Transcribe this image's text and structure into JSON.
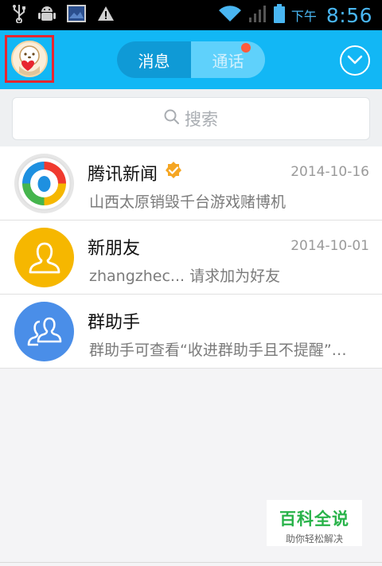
{
  "status_bar": {
    "ampm": "下午",
    "time": "8:56",
    "icons": [
      "usb-icon",
      "android-debug-icon",
      "screenshot-icon",
      "warning-icon",
      "wifi-icon",
      "signal-icon",
      "battery-icon"
    ]
  },
  "header": {
    "tabs": [
      {
        "label": "消息",
        "active": true
      },
      {
        "label": "通话",
        "active": false,
        "badge_dot": true
      }
    ],
    "more_icon": "chevron-down-circle-icon"
  },
  "search": {
    "placeholder": "搜索"
  },
  "conversations": [
    {
      "name": "腾讯新闻",
      "verified": true,
      "date": "2014-10-16",
      "preview": "山西太原销毁千台游戏赌博机",
      "avatar": "tencent-news-icon"
    },
    {
      "name": "新朋友",
      "verified": false,
      "date": "2014-10-01",
      "preview": "zhangzhec... 请求加为好友",
      "avatar": "new-friend-icon",
      "avatar_color": "#f6b700"
    },
    {
      "name": "群助手",
      "verified": false,
      "date": "",
      "preview": "群助手可查看“收进群助手且不提醒”…",
      "avatar": "group-helper-icon",
      "avatar_color": "#4a8ee8"
    }
  ],
  "watermark": {
    "title": "百科全说",
    "subtitle": "助你轻松解决"
  },
  "colors": {
    "accent": "#12b7f5",
    "badge": "#ff5a3c",
    "verified": "#f5a623"
  }
}
